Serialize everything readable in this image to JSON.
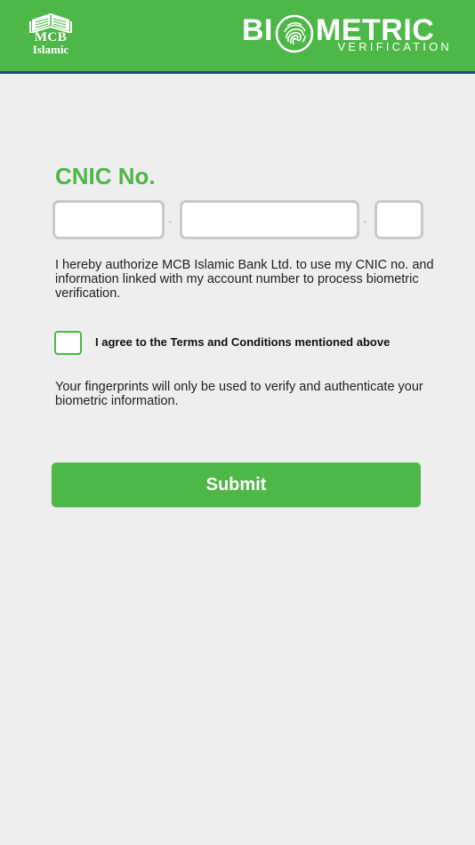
{
  "header": {
    "logo": {
      "text": "MCB",
      "subtext": "Islamic"
    },
    "brand": {
      "title_left": "BI",
      "title_right": "METRIC",
      "subtitle": "VERIFICATION"
    }
  },
  "form": {
    "cnic_label": "CNIC No.",
    "cnic_fields": [
      {
        "value": "",
        "placeholder": ""
      },
      {
        "value": "",
        "placeholder": ""
      },
      {
        "value": "",
        "placeholder": ""
      }
    ],
    "separator": "-",
    "authorization_text": "I hereby authorize MCB Islamic Bank Ltd. to use my CNIC no. and information linked with my account number to process biometric verification.",
    "terms_label": "I agree to the Terms and Conditions mentioned above",
    "terms_checked": false,
    "fingerprint_notice": "Your fingerprints will only be used to verify and authenticate your biometric information.",
    "submit_label": "Submit"
  },
  "colors": {
    "accent": "#4db848",
    "header_border": "#1d4e7a",
    "background": "#eeeeee"
  },
  "icons": [
    "mcb-islamic-logo-icon",
    "fingerprint-icon"
  ]
}
